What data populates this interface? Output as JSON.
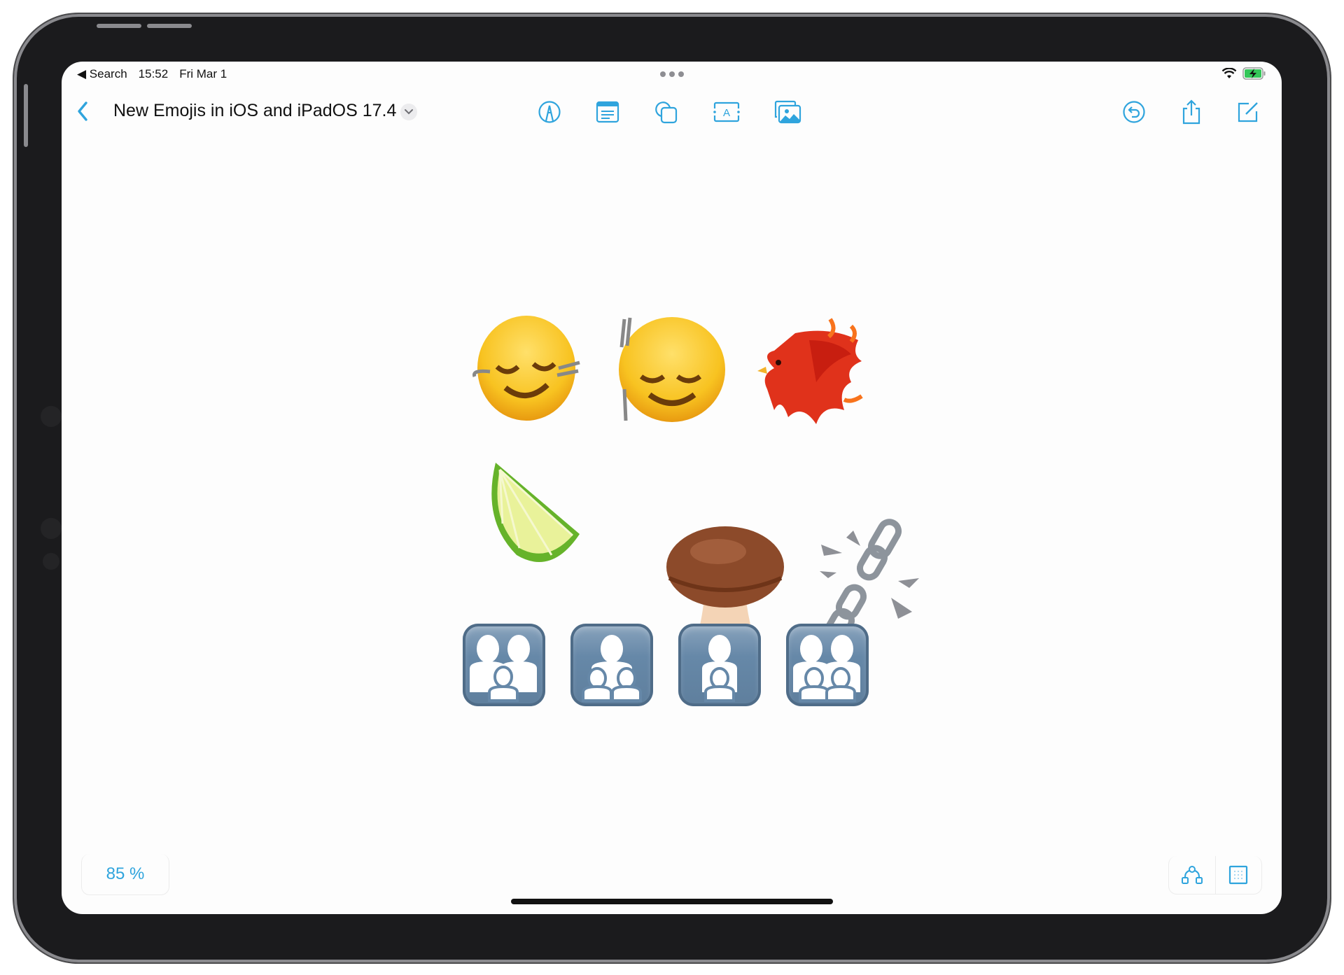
{
  "status_bar": {
    "back_app": "◀ Search",
    "time": "15:52",
    "date": "Fri Mar 1",
    "battery_color": "#34c759",
    "charging": true
  },
  "nav": {
    "title": "New Emojis in iOS and iPadOS 17.4",
    "accent": "#2fa4dd",
    "tools": [
      "pen-tool",
      "sticky-note",
      "shapes",
      "text-box",
      "media"
    ],
    "right_actions": [
      "undo",
      "share",
      "compose"
    ]
  },
  "board": {
    "emojis_row1": [
      "🙂‍↔️",
      "🙂‍↕️",
      "🐦‍🔥"
    ],
    "emojis_row1_names": [
      "head-shaking-horizontally",
      "head-shaking-vertically",
      "phoenix"
    ],
    "emojis_row2": [
      "🍋‍🟩",
      "🍄‍🟫",
      "⛓️‍💥"
    ],
    "emojis_row2_names": [
      "lime",
      "brown-mushroom",
      "broken-chain"
    ],
    "family_symbols": [
      "adult-adult-child",
      "adult-child-child",
      "adult-child",
      "adult-adult-child-child"
    ]
  },
  "footer": {
    "zoom_level": "85 %"
  }
}
